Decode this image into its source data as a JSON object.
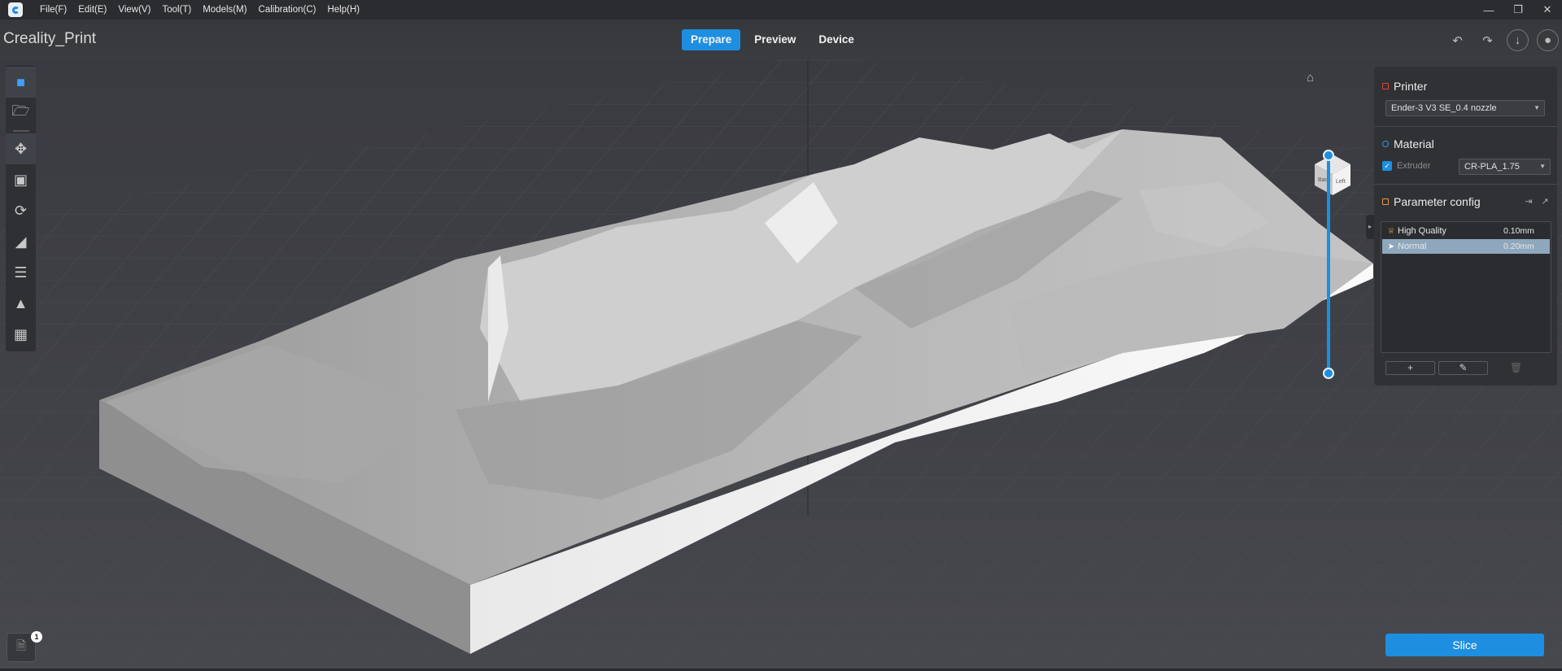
{
  "menu": [
    "File(F)",
    "Edit(E)",
    "View(V)",
    "Tool(T)",
    "Models(M)",
    "Calibration(C)",
    "Help(H)"
  ],
  "project_title": "Creality_Print",
  "tabs": [
    {
      "label": "Prepare",
      "active": true
    },
    {
      "label": "Preview",
      "active": false
    },
    {
      "label": "Device",
      "active": false
    }
  ],
  "view_cube": {
    "faces": [
      "Back",
      "Left"
    ]
  },
  "right_panel": {
    "printer": {
      "title": "Printer",
      "selected": "Ender-3 V3 SE_0.4 nozzle"
    },
    "material": {
      "title": "Material",
      "extruder_label": "Extruder",
      "extruder_checked": true,
      "selected": "CR-PLA_1.75"
    },
    "parameter_config": {
      "title": "Parameter config",
      "profiles": [
        {
          "name": "High Quality",
          "layer_height": "0.10mm",
          "selected": false
        },
        {
          "name": "Normal",
          "layer_height": "0.20mm",
          "selected": true
        }
      ]
    }
  },
  "file_badge_count": "1",
  "slice_label": "Slice",
  "colors": {
    "accent": "#1e8ee0",
    "background": "#3c3e43",
    "panel": "#2f3135",
    "model": "#d6d6d6"
  }
}
